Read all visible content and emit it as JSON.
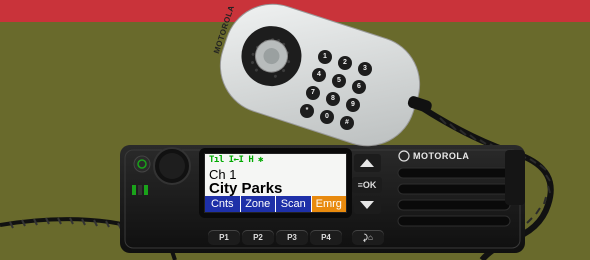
{
  "colors": {
    "top_band": "#c9333a",
    "background": "#696a2c",
    "radio_body": "#1a1a1a",
    "mic_body": "#dcdfdf",
    "softkey_blue": "#1e30a8",
    "softkey_orange": "#e88a0e",
    "signal_green": "#1aa31a"
  },
  "mic": {
    "brand": "MOTOROLA",
    "keys": [
      "1",
      "2",
      "3",
      "4",
      "5",
      "6",
      "7",
      "8",
      "9",
      "*",
      "0",
      "#"
    ]
  },
  "radio": {
    "brand": "MOTOROLA",
    "ok_label": "≡OK",
    "display": {
      "status_icons": "Tıl I←I H ✱",
      "channel": "Ch 1",
      "zone": "City Parks",
      "softkeys": [
        "Cnts",
        "Zone",
        "Scan",
        "Emrg"
      ]
    },
    "programmable_buttons": [
      "P1",
      "P2",
      "P3",
      "P4"
    ],
    "back_home_label": "⤸⌂"
  }
}
